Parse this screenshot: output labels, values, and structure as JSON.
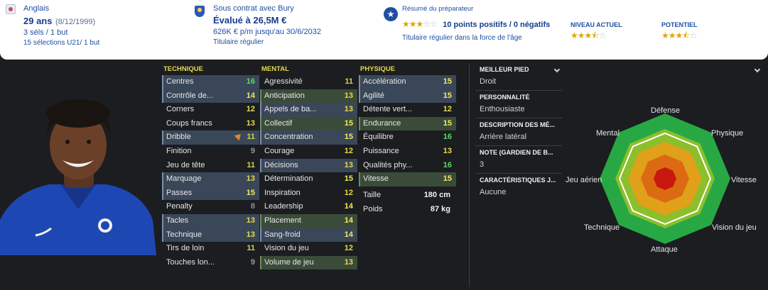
{
  "header": {
    "nationality": "Anglais",
    "age": "29 ans",
    "dob": "(8/12/1999)",
    "caps": "3 séls / 1 but",
    "u21": "15 sélections U21/ 1 but",
    "contract": "Sous contrat avec Bury",
    "value": "Évalué à 26,5M €",
    "wage": "626K € p/m jusqu'au 30/6/2032",
    "role": "Titulaire régulier",
    "scout_title": "Résumé du préparateur",
    "scout_points": "10 points positifs / 0 négatifs",
    "scout_summary": "Titulaire régulier dans la force de l'âge",
    "current_label": "NIVEAU ACTUEL",
    "potential_label": "POTENTIEL",
    "scout_stars": 3,
    "current_stars": 3.5,
    "potential_stars": 3.5
  },
  "technique": {
    "title": "TECHNIQUE",
    "rows": [
      {
        "label": "Centres",
        "value": "16"
      },
      {
        "label": "Contrôle de...",
        "value": "14"
      },
      {
        "label": "Corners",
        "value": "12"
      },
      {
        "label": "Coups francs",
        "value": "13"
      },
      {
        "label": "Dribble",
        "value": "11"
      },
      {
        "label": "Finition",
        "value": "9"
      },
      {
        "label": "Jeu de tête",
        "value": "11"
      },
      {
        "label": "Marquage",
        "value": "13"
      },
      {
        "label": "Passes",
        "value": "15"
      },
      {
        "label": "Penalty",
        "value": "8"
      },
      {
        "label": "Tacles",
        "value": "13"
      },
      {
        "label": "Technique",
        "value": "13"
      },
      {
        "label": "Tirs de loin",
        "value": "11"
      },
      {
        "label": "Touches lon...",
        "value": "9"
      }
    ]
  },
  "mental": {
    "title": "MENTAL",
    "rows": [
      {
        "label": "Agressivité",
        "value": "11"
      },
      {
        "label": "Anticipation",
        "value": "13"
      },
      {
        "label": "Appels de ba...",
        "value": "13"
      },
      {
        "label": "Collectif",
        "value": "15"
      },
      {
        "label": "Concentration",
        "value": "15"
      },
      {
        "label": "Courage",
        "value": "12"
      },
      {
        "label": "Décisions",
        "value": "13"
      },
      {
        "label": "Détermination",
        "value": "15"
      },
      {
        "label": "Inspiration",
        "value": "12"
      },
      {
        "label": "Leadership",
        "value": "14"
      },
      {
        "label": "Placement",
        "value": "14"
      },
      {
        "label": "Sang-froid",
        "value": "14"
      },
      {
        "label": "Vision du jeu",
        "value": "12"
      },
      {
        "label": "Volume de jeu",
        "value": "13"
      }
    ]
  },
  "physique": {
    "title": "PHYSIQUE",
    "rows": [
      {
        "label": "Accélération",
        "value": "15"
      },
      {
        "label": "Agilité",
        "value": "15"
      },
      {
        "label": "Détente vert...",
        "value": "12"
      },
      {
        "label": "Endurance",
        "value": "15"
      },
      {
        "label": "Équilibre",
        "value": "16"
      },
      {
        "label": "Puissance",
        "value": "13"
      },
      {
        "label": "Qualités phy...",
        "value": "16"
      },
      {
        "label": "Vitesse",
        "value": "15"
      }
    ],
    "height_label": "Taille",
    "height": "180 cm",
    "weight_label": "Poids",
    "weight": "87 kg"
  },
  "info": {
    "foot_label": "MEILLEUR PIED",
    "foot": "Droit",
    "personality_label": "PERSONNALITÉ",
    "personality": "Enthousiaste",
    "position_label": "DESCRIPTION DES MÉ...",
    "position": "Arrière latéral",
    "gk_label": "NOTE (GARDIEN DE B...",
    "gk": "3",
    "traits_label": "CARACTÉRISTIQUES J...",
    "traits": "Aucune"
  },
  "radar": {
    "labels": [
      "Défense",
      "Physique",
      "Vitesse",
      "Vision du jeu",
      "Attaque",
      "Technique",
      "Jeu aérien",
      "Mental"
    ],
    "colors": {
      "outer": "#27a844",
      "ring2": "#8bbf2b",
      "ring3": "#e0a019",
      "ring4": "#db6a12",
      "core": "#c8170f"
    }
  }
}
